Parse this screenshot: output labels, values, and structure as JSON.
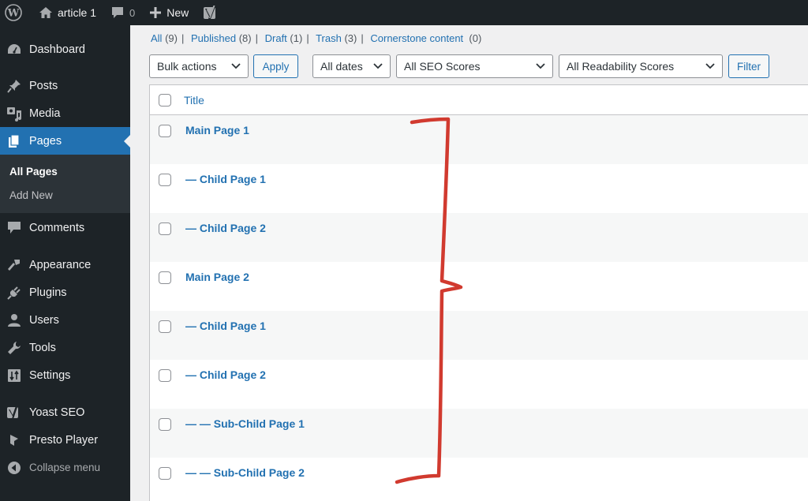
{
  "adminbar": {
    "wp_logo": "wordpress-logo",
    "site_name": "article 1",
    "comments_count": "0",
    "new_label": "New",
    "yoast_icon": "yoast-icon"
  },
  "sidebar": {
    "items": [
      {
        "label": "Dashboard",
        "icon": "dashboard-icon"
      },
      {
        "label": "Posts",
        "icon": "pin-icon"
      },
      {
        "label": "Media",
        "icon": "media-icon"
      },
      {
        "label": "Pages",
        "icon": "pages-icon",
        "current": true
      },
      {
        "label": "Comments",
        "icon": "comment-icon"
      },
      {
        "label": "Appearance",
        "icon": "paintbrush-icon"
      },
      {
        "label": "Plugins",
        "icon": "plug-icon"
      },
      {
        "label": "Users",
        "icon": "user-icon"
      },
      {
        "label": "Tools",
        "icon": "wrench-icon"
      },
      {
        "label": "Settings",
        "icon": "settings-icon"
      },
      {
        "label": "Yoast SEO",
        "icon": "yoast-icon"
      },
      {
        "label": "Presto Player",
        "icon": "presto-icon"
      }
    ],
    "submenu": [
      {
        "label": "All Pages",
        "current": true
      },
      {
        "label": "Add New"
      }
    ],
    "collapse_label": "Collapse menu"
  },
  "filters": {
    "views": [
      {
        "label": "All",
        "count": "(9)"
      },
      {
        "label": "Published",
        "count": "(8)"
      },
      {
        "label": "Draft",
        "count": "(1)"
      },
      {
        "label": "Trash",
        "count": "(3)"
      },
      {
        "label": "Cornerstone content",
        "count": "(0)"
      }
    ],
    "separator": "|",
    "bulk_actions": "Bulk actions",
    "apply": "Apply",
    "dates": "All dates",
    "seo_scores": "All SEO Scores",
    "readability_scores": "All Readability Scores",
    "filter": "Filter"
  },
  "table": {
    "header_title": "Title",
    "rows": [
      {
        "title": "Main Page 1"
      },
      {
        "title": "— Child Page 1"
      },
      {
        "title": "— Child Page 2"
      },
      {
        "title": "Main Page 2"
      },
      {
        "title": "— Child Page 1"
      },
      {
        "title": "— Child Page 2"
      },
      {
        "title": "— — Sub-Child Page 1"
      },
      {
        "title": "— — Sub-Child Page 2"
      }
    ]
  },
  "annotation": {
    "type": "curly-brace",
    "color": "#d13a2f"
  }
}
